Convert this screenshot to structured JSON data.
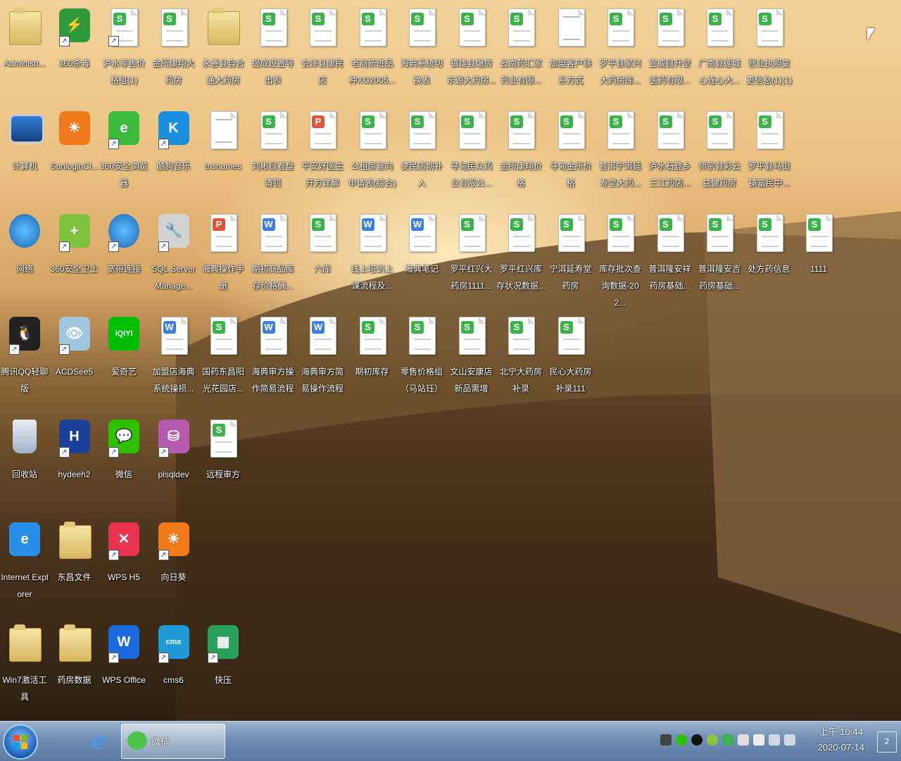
{
  "desktop": {
    "icons": [
      {
        "label": "Administr...",
        "type": "user",
        "color": "#c49a5a"
      },
      {
        "label": "360杀毒",
        "type": "app",
        "color": "#2f9b3c",
        "glyph": "⚡",
        "shortcut": true
      },
      {
        "label": "泸水零售价格组(1)",
        "type": "sheet",
        "shortcut": true
      },
      {
        "label": "金所康翔大药房",
        "type": "sheet"
      },
      {
        "label": "永善县自合通大药房",
        "type": "folder"
      },
      {
        "label": "提成设置导出表",
        "type": "sheet"
      },
      {
        "label": "会泽县康民店",
        "type": "sheet"
      },
      {
        "label": "老商新进品种XG2005...",
        "type": "sheet"
      },
      {
        "label": "海典系统切换表",
        "type": "sheet"
      },
      {
        "label": "镇雄县塘房东源大药房...",
        "type": "sheet"
      },
      {
        "label": "云南药汇家药业有限...",
        "type": "sheet"
      },
      {
        "label": "加盟客户联系方式",
        "type": "text"
      },
      {
        "label": "罗平县家兴大药房库...",
        "type": "sheet"
      },
      {
        "label": "宣威目升堂医药有限...",
        "type": "sheet"
      },
      {
        "label": "广南县莲城心连心大...",
        "type": "sheet"
      },
      {
        "label": "营业执照变更信息(1)(1)",
        "type": "sheet"
      },
      {
        "label": "计算机",
        "type": "computer"
      },
      {
        "label": "SunloginCl...",
        "type": "app",
        "color": "#f07a1a",
        "glyph": "☀"
      },
      {
        "label": "360安全浏览器",
        "type": "app",
        "color": "#3dbb3d",
        "glyph": "e",
        "shortcut": true
      },
      {
        "label": "酷狗音乐",
        "type": "app",
        "color": "#1a8fe0",
        "glyph": "K",
        "shortcut": true
      },
      {
        "label": "tnsnames",
        "type": "text"
      },
      {
        "label": "刘彬目看盘请罚",
        "type": "sheet"
      },
      {
        "label": "平安好医生开方详解",
        "type": "ppt"
      },
      {
        "label": "公租房意向申请表(综合)",
        "type": "sheet"
      },
      {
        "label": "便民店期补入",
        "type": "sheet"
      },
      {
        "label": "寻甸民众药业有限公...",
        "type": "sheet"
      },
      {
        "label": "金所康翔价格",
        "type": "sheet"
      },
      {
        "label": "寻甸金所价格",
        "type": "sheet"
      },
      {
        "label": "普洱宁洱延寿堂大药...",
        "type": "sheet"
      },
      {
        "label": "泸水石登乡三江药店...",
        "type": "sheet"
      },
      {
        "label": "师宗县彩云益健药房",
        "type": "sheet"
      },
      {
        "label": "罗平县马街镇富民中...",
        "type": "sheet"
      },
      {
        "label": "网络",
        "type": "network"
      },
      {
        "label": "360安全卫士",
        "type": "app",
        "color": "#7cc23a",
        "glyph": "+",
        "shortcut": true
      },
      {
        "label": "宽带连接",
        "type": "network2",
        "shortcut": true
      },
      {
        "label": "SQL Server Manage...",
        "type": "app",
        "color": "#d2d2d2",
        "glyph": "🔧",
        "shortcut": true
      },
      {
        "label": "海典操作手册",
        "type": "ppt2"
      },
      {
        "label": "期初商品库存价格确...",
        "type": "doc"
      },
      {
        "label": "六库",
        "type": "sheet"
      },
      {
        "label": "线上培训上课流程及...",
        "type": "doc"
      },
      {
        "label": "海典笔记",
        "type": "doc"
      },
      {
        "label": "罗平红兴大药房1111...",
        "type": "sheet"
      },
      {
        "label": "罗平红兴库存状况数据...",
        "type": "sheet"
      },
      {
        "label": "宁洱延寿堂药房",
        "type": "sheet"
      },
      {
        "label": "库存批次查询数据-202...",
        "type": "sheet"
      },
      {
        "label": "普洱隆安祥药房基础...",
        "type": "sheet"
      },
      {
        "label": "普洱隆安吉药房基础...",
        "type": "sheet"
      },
      {
        "label": "处方药信息",
        "type": "sheet"
      },
      {
        "label": "1111",
        "type": "sheet"
      },
      {
        "label": "腾讯QQ轻聊版",
        "type": "app",
        "color": "#222",
        "glyph": "🐧",
        "shortcut": true
      },
      {
        "label": "ACDSee5",
        "type": "app",
        "color": "#9fc7df",
        "glyph": "👁",
        "shortcut": true
      },
      {
        "label": "爱奇艺",
        "type": "app",
        "color": "#00be06",
        "glyph": "iQIYI"
      },
      {
        "label": "加盟店海典系统操损...",
        "type": "doc"
      },
      {
        "label": "国药东昌阳光花园店...",
        "type": "sheet"
      },
      {
        "label": "海典审方操作简易流程",
        "type": "doc"
      },
      {
        "label": "海典审方简易操作流程",
        "type": "doc"
      },
      {
        "label": "期初库存",
        "type": "sheet"
      },
      {
        "label": "零售价格组（马站珏）",
        "type": "sheet"
      },
      {
        "label": "文山安康店新品需增",
        "type": "sheet"
      },
      {
        "label": "北宁大药房补录",
        "type": "sheet"
      },
      {
        "label": "民心大药房补录111",
        "type": "sheet"
      },
      {
        "label": "回收站",
        "type": "recycle"
      },
      {
        "label": "hydeeh2",
        "type": "app",
        "color": "#1c3f9a",
        "glyph": "H",
        "shortcut": true
      },
      {
        "label": "微信",
        "type": "app",
        "color": "#2dc100",
        "glyph": "💬",
        "shortcut": true
      },
      {
        "label": "plsqldev",
        "type": "app",
        "color": "#b85ab0",
        "glyph": "⛁",
        "shortcut": true
      },
      {
        "label": "远程审方",
        "type": "sheet"
      },
      {
        "label": "Internet Explorer",
        "type": "app",
        "color": "#2a8fe8",
        "glyph": "e"
      },
      {
        "label": "东昌文件",
        "type": "folder"
      },
      {
        "label": "WPS H5",
        "type": "app",
        "color": "#e8334e",
        "glyph": "✕",
        "shortcut": true
      },
      {
        "label": "向日葵",
        "type": "app",
        "color": "#f07a1a",
        "glyph": "☀",
        "shortcut": true
      },
      {
        "label": "Win7激活工具",
        "type": "folder"
      },
      {
        "label": "药房数据",
        "type": "folder"
      },
      {
        "label": "WPS Office",
        "type": "app",
        "color": "#1a6be0",
        "glyph": "W",
        "shortcut": true
      },
      {
        "label": "cms6",
        "type": "app",
        "color": "#1f9ad6",
        "glyph": "cms",
        "shortcut": true
      },
      {
        "label": "快压",
        "type": "app",
        "color": "#2aa05a",
        "glyph": "▦",
        "shortcut": true
      }
    ]
  },
  "taskbar": {
    "active_task": "微信",
    "clock_time": "上午 10:44",
    "clock_date": "2020-07-14",
    "desktop_badge": "2"
  }
}
